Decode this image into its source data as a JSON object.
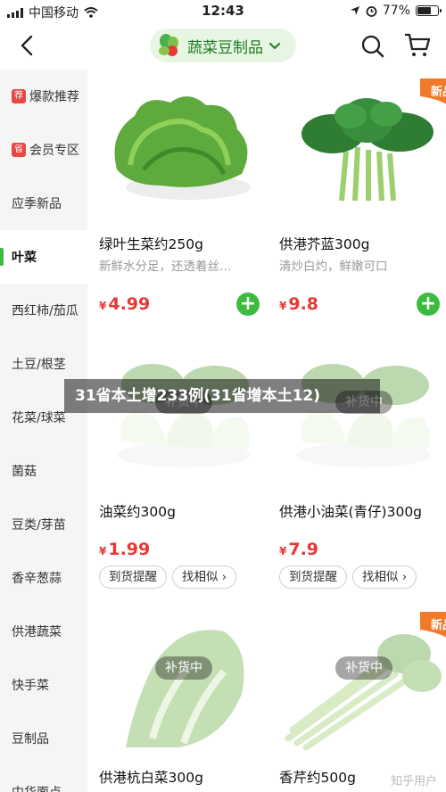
{
  "status_bar": {
    "carrier": "中国移动",
    "time": "12:43",
    "battery": "77%",
    "battery_level": 0.77
  },
  "nav": {
    "category_label": "蔬菜豆制品",
    "icons": [
      "back-icon",
      "vegetable-basket-icon",
      "chevron-down-icon",
      "search-icon",
      "cart-icon"
    ]
  },
  "sidebar": {
    "items": [
      {
        "tag": "荐",
        "label": "爆款推荐"
      },
      {
        "tag": "省",
        "label": "会员专区"
      },
      {
        "tag": "",
        "label": "应季新品"
      },
      {
        "tag": "",
        "label": "叶菜",
        "active": true
      },
      {
        "tag": "",
        "label": "西红柿/茄瓜"
      },
      {
        "tag": "",
        "label": "土豆/根茎"
      },
      {
        "tag": "",
        "label": "花菜/球菜"
      },
      {
        "tag": "",
        "label": "菌菇"
      },
      {
        "tag": "",
        "label": "豆类/芽苗"
      },
      {
        "tag": "",
        "label": "香辛葱蒜"
      },
      {
        "tag": "",
        "label": "供港蔬菜"
      },
      {
        "tag": "",
        "label": "快手菜"
      },
      {
        "tag": "",
        "label": "豆制品"
      },
      {
        "tag": "",
        "label": "中华面点"
      }
    ]
  },
  "products": [
    {
      "name": "绿叶生菜约250g",
      "sub": "新鲜水分足，还透着丝…",
      "currency": "¥",
      "price": "4.99",
      "new_badge": "",
      "out_of_stock": false
    },
    {
      "name": "供港芥蓝300g",
      "sub": "清炒白灼，鲜嫩可口",
      "currency": "¥",
      "price": "9.8",
      "new_badge": "新品",
      "out_of_stock": false
    },
    {
      "name": "油菜约300g",
      "sub": "",
      "currency": "¥",
      "price": "1.99",
      "new_badge": "",
      "out_of_stock": true,
      "oos_label": "补货中",
      "btn_remind": "到货提醒",
      "btn_similar": "找相似 ›"
    },
    {
      "name": "供港小油菜(青仔)300g",
      "sub": "",
      "currency": "¥",
      "price": "7.9",
      "new_badge": "",
      "out_of_stock": true,
      "oos_label": "补货中",
      "btn_remind": "到货提醒",
      "btn_similar": "找相似 ›"
    },
    {
      "name": "供港杭白菜300g",
      "sub": "",
      "currency": "",
      "price": "",
      "new_badge": "",
      "out_of_stock": true,
      "oos_label": "补货中"
    },
    {
      "name": "香芹约500g",
      "sub": "",
      "currency": "",
      "price": "",
      "new_badge": "新品",
      "out_of_stock": true,
      "oos_label": "补货中"
    }
  ],
  "add_label": "+",
  "overlay_title": "31省本土增233例(31省增本土12)",
  "watermark": "知乎用户",
  "colors": {
    "accent_green": "#3dbb40",
    "price_red": "#e53935",
    "pill_bg": "#e7f6e2",
    "new_badge_orange": "#f07a2a"
  }
}
